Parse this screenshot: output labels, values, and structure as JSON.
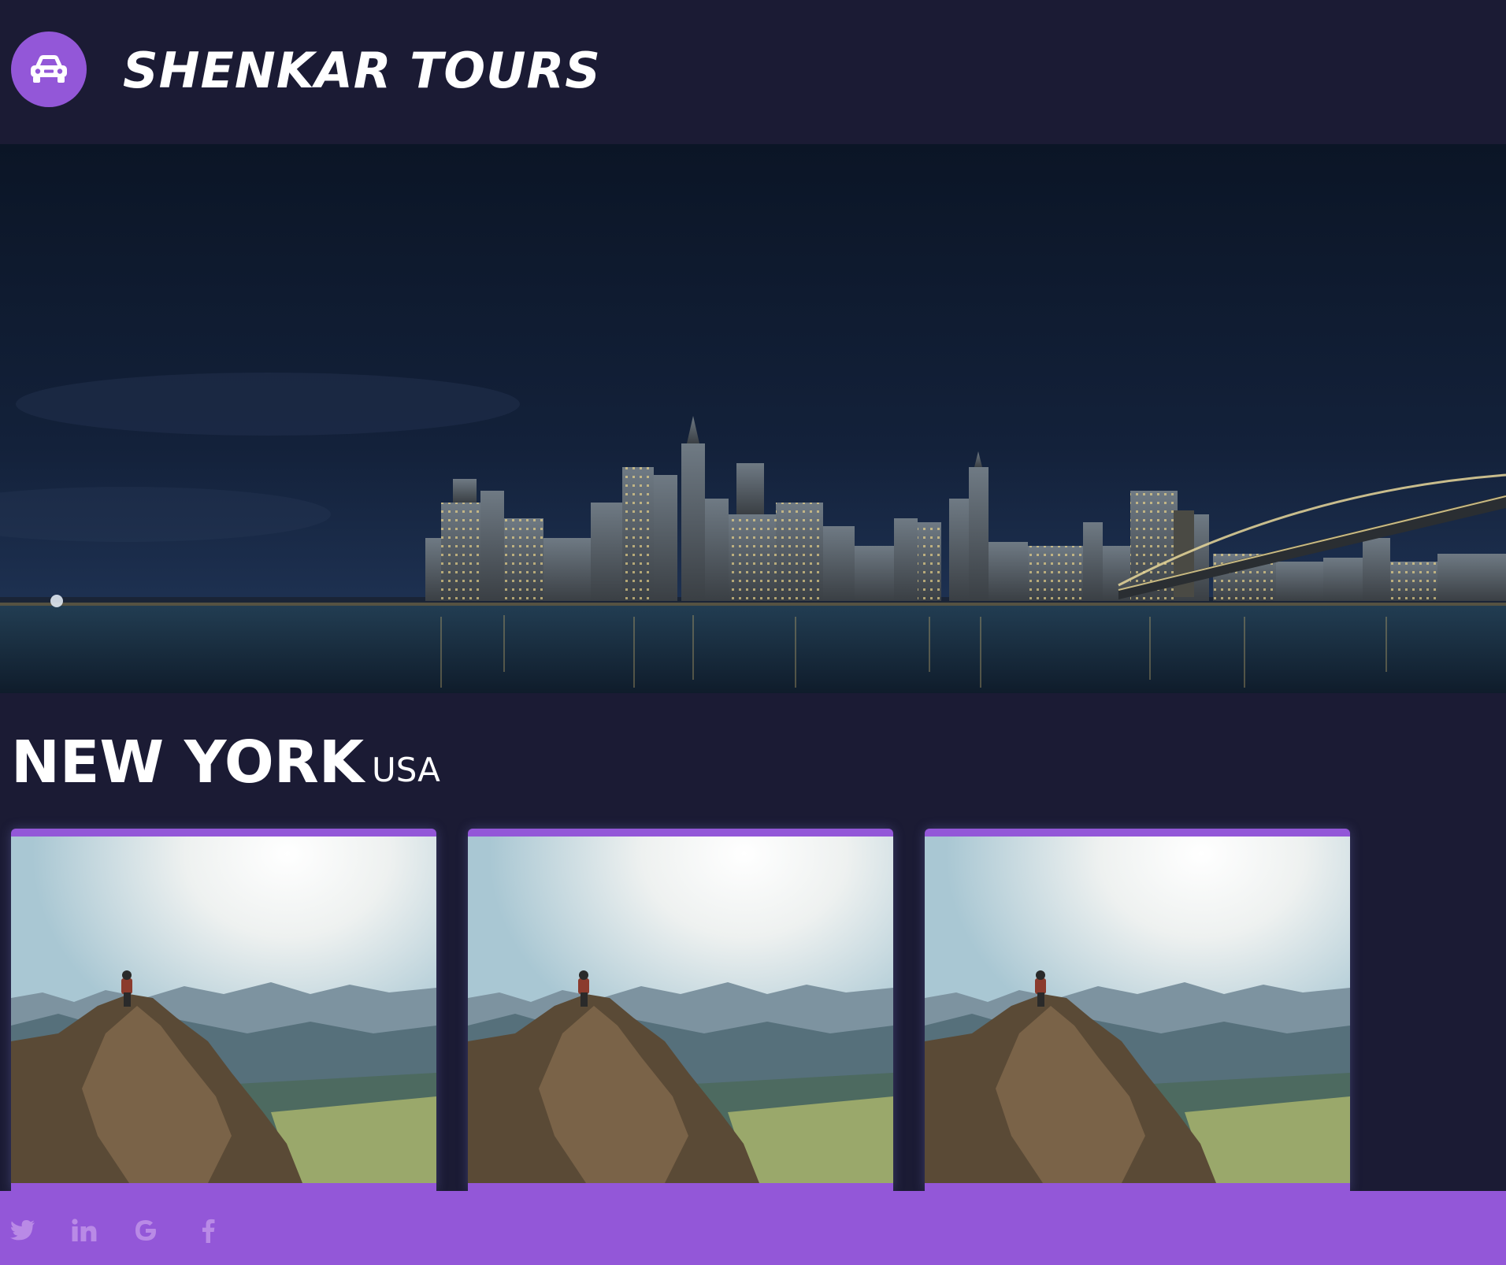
{
  "header": {
    "brand": "SHENKAR TOURS",
    "logo_icon": "car-icon",
    "logo_color": "#9357d8"
  },
  "hero": {
    "image": "new-york-skyline-at-night"
  },
  "destination": {
    "city": "NEW YORK",
    "country": "USA"
  },
  "cards": [
    {
      "image": "hiker-on-mountain-peak"
    },
    {
      "image": "hiker-on-mountain-peak"
    },
    {
      "image": "hiker-on-mountain-peak"
    }
  ],
  "footer": {
    "social": [
      "twitter-icon",
      "linkedin-icon",
      "google-icon",
      "facebook-icon"
    ]
  },
  "colors": {
    "background": "#1b1b34",
    "accent": "#9357d8",
    "social_icon": "#b98ae6"
  }
}
